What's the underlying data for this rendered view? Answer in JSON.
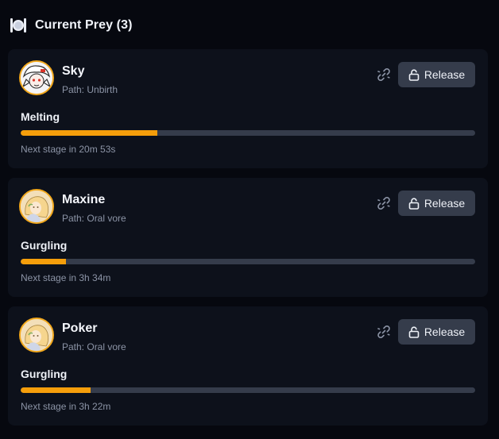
{
  "header": {
    "title": "Current Prey (3)",
    "icon": "plate-cutlery-icon"
  },
  "colors": {
    "accent": "#f59e0b",
    "card_bg": "#0d111b",
    "page_bg": "#06080f",
    "button_bg": "#353c4b",
    "track_bg": "#353c4b"
  },
  "prey": [
    {
      "name": "Sky",
      "path": "Path: Unbirth",
      "stage": "Melting",
      "progress": 0.3,
      "next_stage": "Next stage in 20m 53s",
      "release_label": "Release",
      "avatar": "white-haired-character-avatar"
    },
    {
      "name": "Maxine",
      "path": "Path: Oral vore",
      "stage": "Gurgling",
      "progress": 0.1,
      "next_stage": "Next stage in 3h 34m",
      "release_label": "Release",
      "avatar": "blonde-character-avatar"
    },
    {
      "name": "Poker",
      "path": "Path: Oral vore",
      "stage": "Gurgling",
      "progress": 0.154,
      "next_stage": "Next stage in 3h 22m",
      "release_label": "Release",
      "avatar": "blonde-character-avatar"
    }
  ]
}
